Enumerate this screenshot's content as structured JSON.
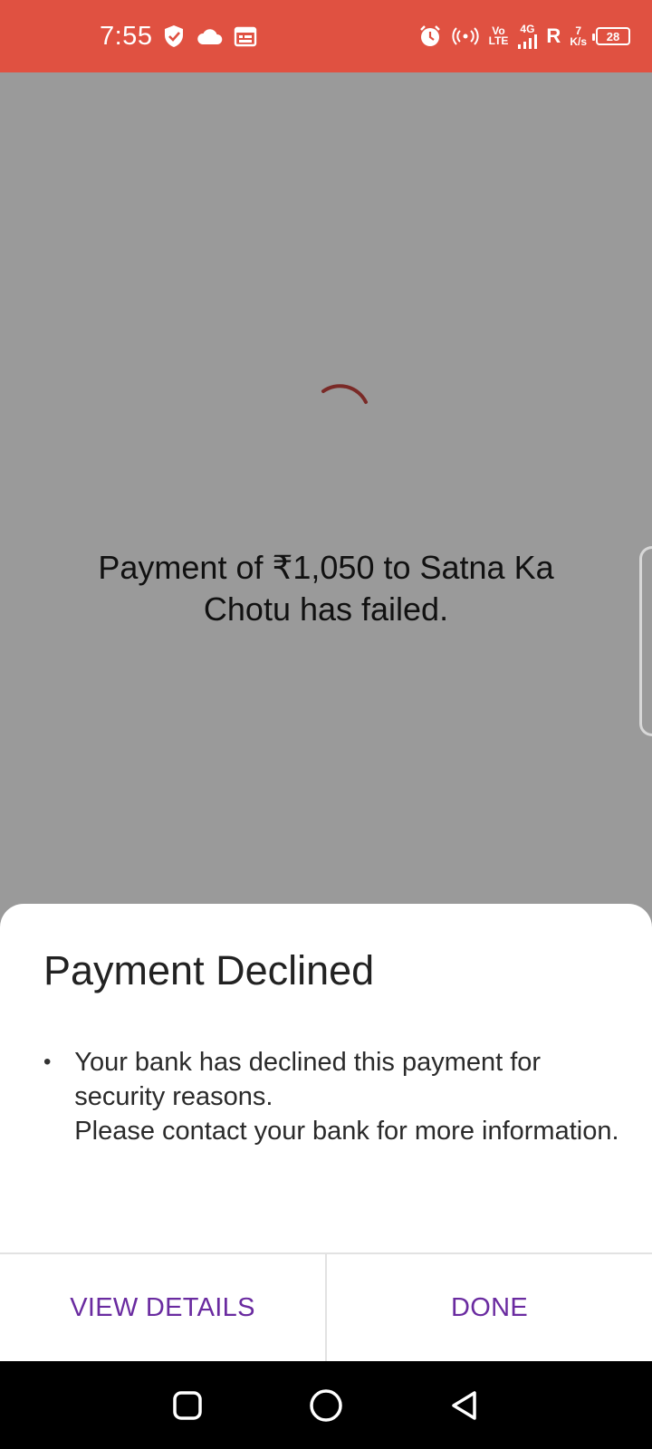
{
  "status_bar": {
    "time": "7:55",
    "left_icons": [
      "shield-check-icon",
      "cloud-icon",
      "calendar-icon"
    ],
    "network_top": "Vo",
    "network_bottom": "LTE",
    "network_type": "4G",
    "roaming": "R",
    "speed_value": "7",
    "speed_unit": "K/s",
    "battery_level": "28",
    "color": "#e05141"
  },
  "main": {
    "fail_message": "Payment of ₹1,050 to Satna Ka Chotu has failed."
  },
  "sheet": {
    "title": "Payment Declined",
    "bullet": "•",
    "message_line1": "Your bank has declined this payment for security reasons.",
    "message_line2": "Please contact your bank for more information.",
    "view_details_label": "VIEW DETAILS",
    "done_label": "DONE",
    "accent": "#6a2ba0"
  },
  "nav_bar": {
    "buttons": [
      "recents-icon",
      "home-icon",
      "back-icon"
    ]
  }
}
